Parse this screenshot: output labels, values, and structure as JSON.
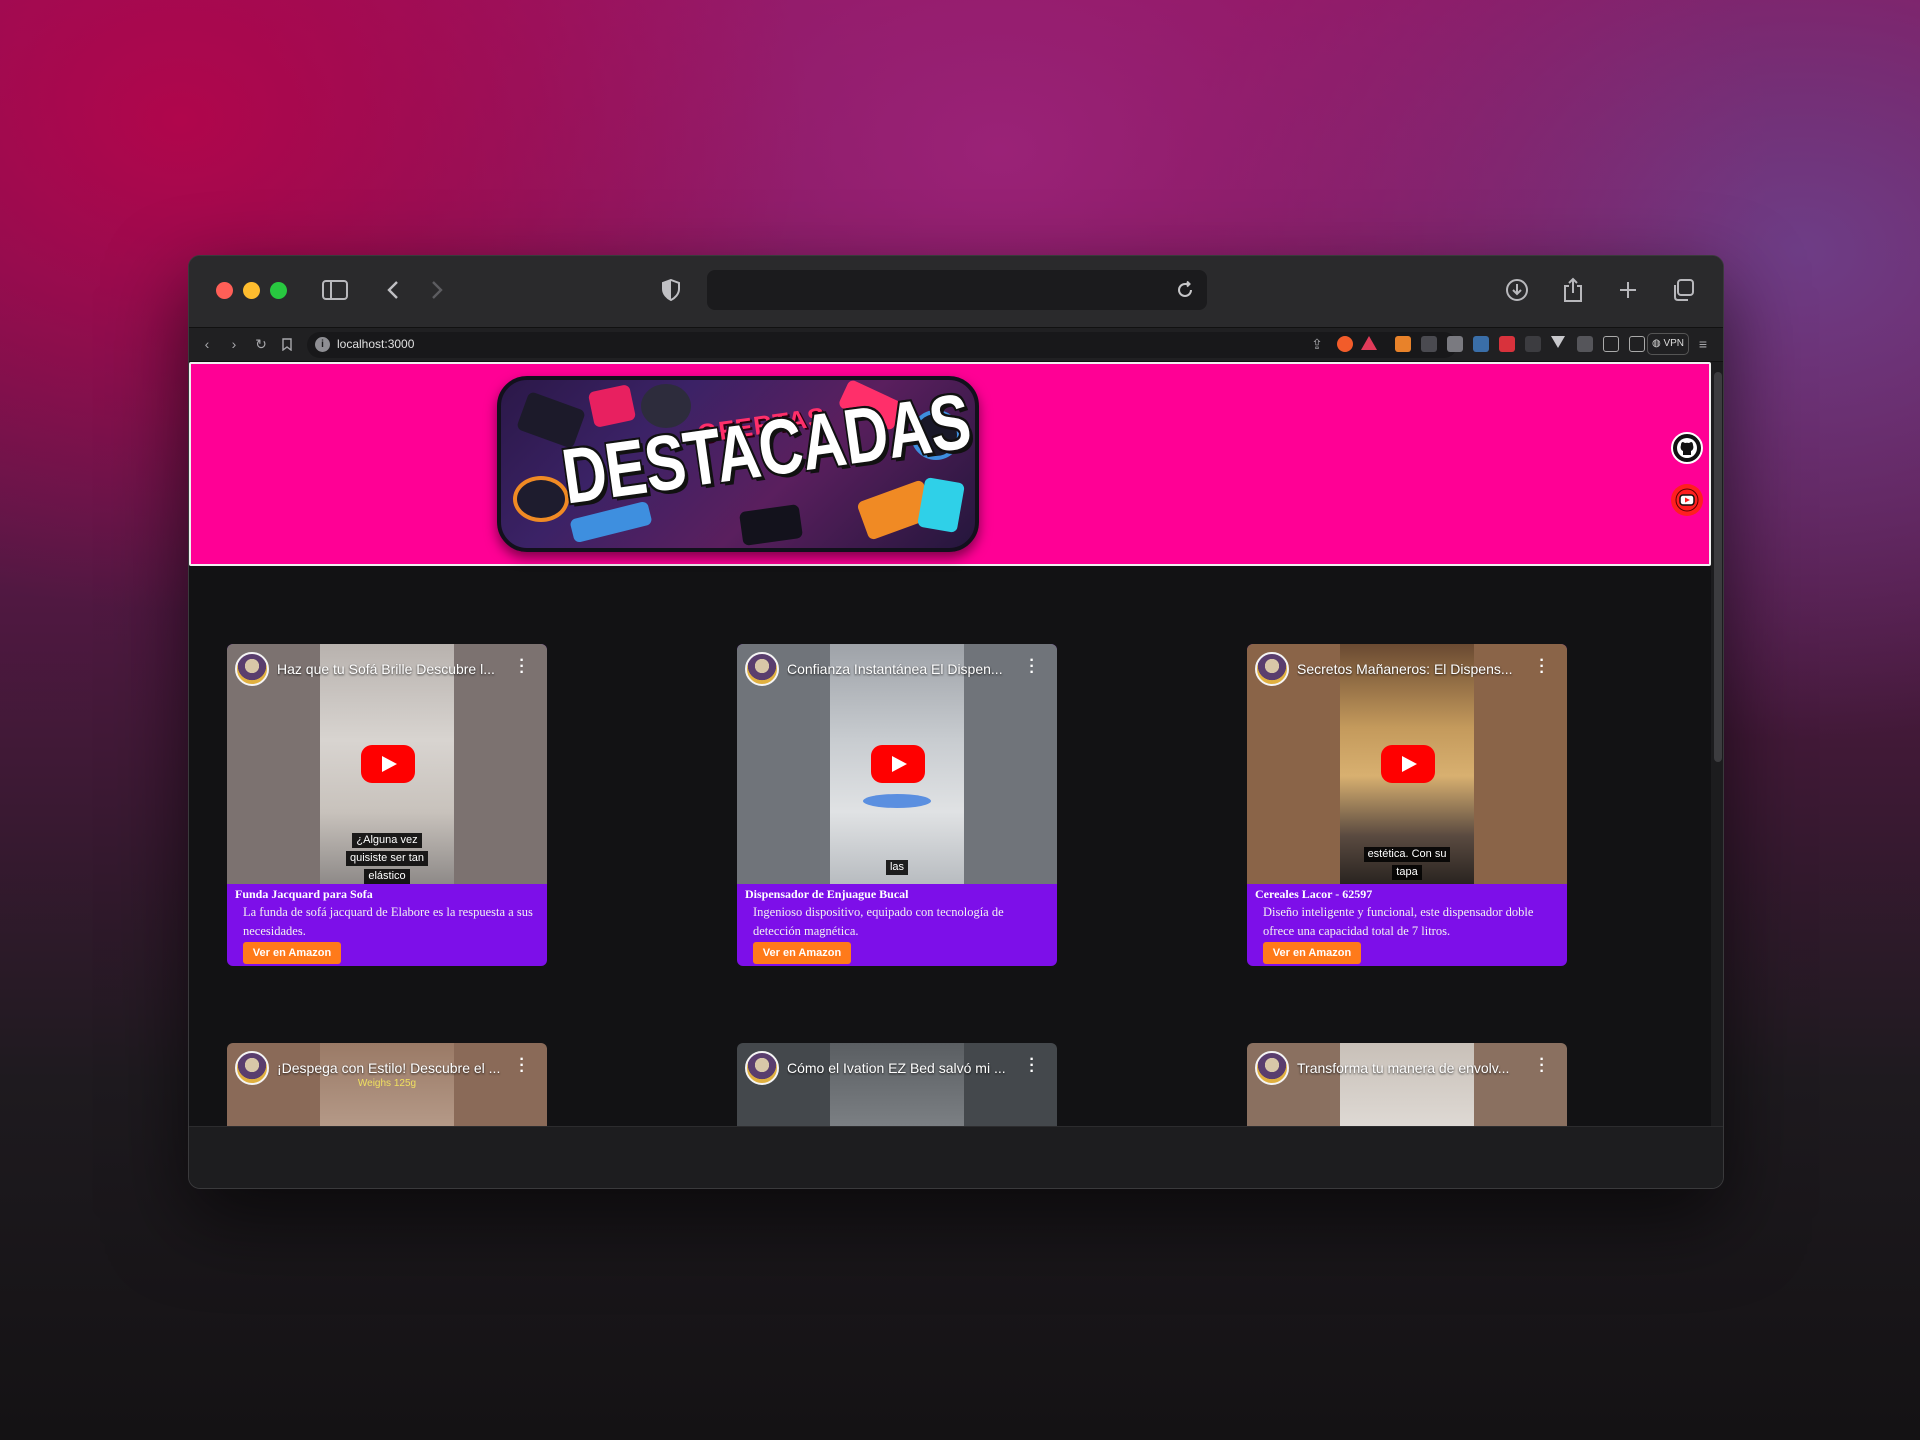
{
  "browser": {
    "url": "localhost:3000",
    "vpn_label": "VPN"
  },
  "header": {
    "banner_subtitle": "OFERTAS",
    "banner_title": "DESTACADAS",
    "bg_color": "#ff0095"
  },
  "social": {
    "github_icon": "github-icon",
    "youtube_icon": "youtube-icon"
  },
  "products": [
    {
      "video_title": "Haz que tu Sofá Brille Descubre l...",
      "caption": [
        "¿Alguna vez",
        "quisiste ser tan",
        "elástico"
      ],
      "title": "Funda Jacquard para Sofa",
      "description": "La funda de sofá jacquard de Elabore es la respuesta a sus necesidades.",
      "button": "Ver en Amazon"
    },
    {
      "video_title": "Confianza Instantánea El Dispen...",
      "caption": [
        "las"
      ],
      "title": "Dispensador de Enjuague Bucal",
      "description": "Ingenioso dispositivo, equipado con tecnología de detección magnética.",
      "button": "Ver en Amazon"
    },
    {
      "video_title": "Secretos Mañaneros: El Dispens...",
      "caption": [
        "estética. Con su",
        "tapa"
      ],
      "title": "Cereales Lacor - 62597",
      "description": "Diseño inteligente y funcional, este dispensador doble ofrece una capacidad total de 7 litros.",
      "button": "Ver en Amazon"
    },
    {
      "video_title": "¡Despega con Estilo! Descubre el ...",
      "caption": [
        "Weighs 125g"
      ]
    },
    {
      "video_title": "Cómo el Ivation EZ Bed salvó mi ..."
    },
    {
      "video_title": "Transforma tu manera de envolv..."
    }
  ],
  "colors": {
    "card_bg": "#7d0fe9",
    "button_bg": "#ff7a1a",
    "page_bg": "#121214"
  }
}
